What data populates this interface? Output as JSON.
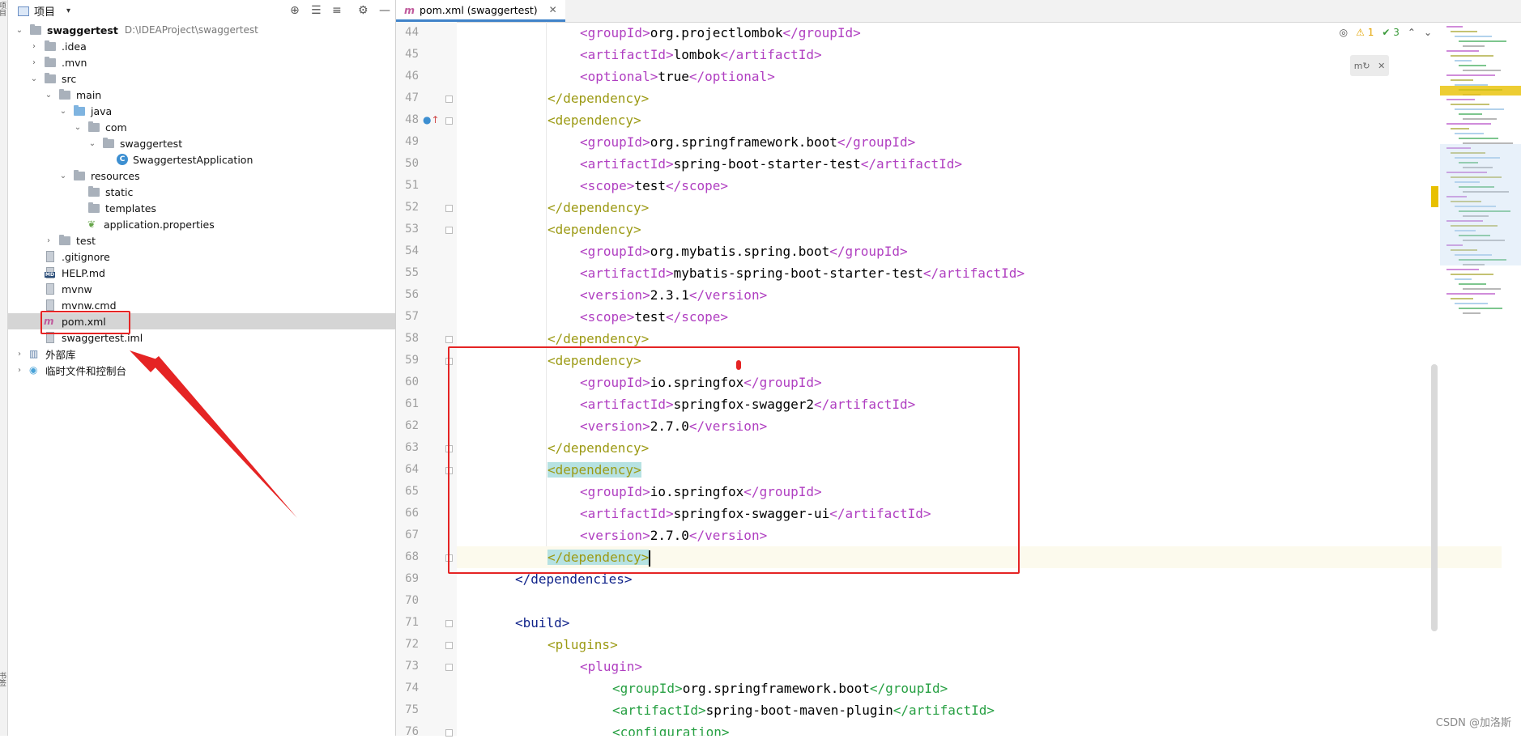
{
  "toolstrip": {
    "top_label": "项目",
    "bottom_label": "书签"
  },
  "project_panel": {
    "title": "项目",
    "dropdown_icon": "chevron-down-icon",
    "header_icons": [
      "locate-icon",
      "expand-all-icon",
      "collapse-all-icon",
      "gear-icon",
      "minimize-icon"
    ],
    "tree": [
      {
        "label": "swaggertest",
        "path": "D:\\IDEAProject\\swaggertest",
        "depth": 0,
        "arrow": "open",
        "icon": "folder-icon",
        "bold": true
      },
      {
        "label": ".idea",
        "depth": 1,
        "arrow": "closed",
        "icon": "folder-icon"
      },
      {
        "label": ".mvn",
        "depth": 1,
        "arrow": "closed",
        "icon": "folder-icon"
      },
      {
        "label": "src",
        "depth": 1,
        "arrow": "open",
        "icon": "folder-icon"
      },
      {
        "label": "main",
        "depth": 2,
        "arrow": "open",
        "icon": "folder-icon"
      },
      {
        "label": "java",
        "depth": 3,
        "arrow": "open",
        "icon": "source-folder-icon"
      },
      {
        "label": "com",
        "depth": 4,
        "arrow": "open",
        "icon": "package-icon"
      },
      {
        "label": "swaggertest",
        "depth": 5,
        "arrow": "open",
        "icon": "package-icon"
      },
      {
        "label": "SwaggertestApplication",
        "depth": 6,
        "arrow": "",
        "icon": "spring-class-icon"
      },
      {
        "label": "resources",
        "depth": 3,
        "arrow": "open",
        "icon": "resources-folder-icon"
      },
      {
        "label": "static",
        "depth": 4,
        "arrow": "",
        "icon": "folder-icon"
      },
      {
        "label": "templates",
        "depth": 4,
        "arrow": "",
        "icon": "folder-icon"
      },
      {
        "label": "application.properties",
        "depth": 4,
        "arrow": "",
        "icon": "spring-properties-icon"
      },
      {
        "label": "test",
        "depth": 2,
        "arrow": "closed",
        "icon": "folder-icon"
      },
      {
        "label": ".gitignore",
        "depth": 1,
        "arrow": "",
        "icon": "gitignore-file-icon"
      },
      {
        "label": "HELP.md",
        "depth": 1,
        "arrow": "",
        "icon": "markdown-file-icon"
      },
      {
        "label": "mvnw",
        "depth": 1,
        "arrow": "",
        "icon": "script-file-icon"
      },
      {
        "label": "mvnw.cmd",
        "depth": 1,
        "arrow": "",
        "icon": "cmd-file-icon"
      },
      {
        "label": "pom.xml",
        "depth": 1,
        "arrow": "",
        "icon": "maven-file-icon",
        "selected": true
      },
      {
        "label": "swaggertest.iml",
        "depth": 1,
        "arrow": "",
        "icon": "iml-file-icon"
      },
      {
        "label": "外部库",
        "depth": 0,
        "arrow": "closed",
        "icon": "library-icon"
      },
      {
        "label": "临时文件和控制台",
        "depth": 0,
        "arrow": "closed",
        "icon": "scratches-icon"
      }
    ]
  },
  "editor": {
    "tab_label": "pom.xml (swaggertest)",
    "tab_icon": "maven-icon",
    "inspection": {
      "warnings": "1",
      "ok": "3"
    },
    "maven_reload_icon": "maven-reload-icon",
    "lines": [
      {
        "n": "44",
        "indent": 3,
        "parts": [
          [
            "t",
            "<groupId>"
          ],
          [
            "txt",
            "org.projectlombok"
          ],
          [
            "t",
            "</groupId>"
          ]
        ]
      },
      {
        "n": "45",
        "indent": 3,
        "parts": [
          [
            "t",
            "<artifactId>"
          ],
          [
            "txt",
            "lombok"
          ],
          [
            "t",
            "</artifactId>"
          ]
        ]
      },
      {
        "n": "46",
        "indent": 3,
        "parts": [
          [
            "t",
            "<optional>"
          ],
          [
            "txt",
            "true"
          ],
          [
            "t",
            "</optional>"
          ]
        ]
      },
      {
        "n": "47",
        "indent": 2,
        "parts": [
          [
            "t2",
            "</dependency>"
          ]
        ],
        "fold": true
      },
      {
        "n": "48",
        "indent": 2,
        "parts": [
          [
            "t2",
            "<dependency>"
          ]
        ],
        "fold": true,
        "gicon": true
      },
      {
        "n": "49",
        "indent": 3,
        "parts": [
          [
            "t",
            "<groupId>"
          ],
          [
            "txt",
            "org.springframework.boot"
          ],
          [
            "t",
            "</groupId>"
          ]
        ]
      },
      {
        "n": "50",
        "indent": 3,
        "parts": [
          [
            "t",
            "<artifactId>"
          ],
          [
            "txt",
            "spring-boot-starter-test"
          ],
          [
            "t",
            "</artifactId>"
          ]
        ]
      },
      {
        "n": "51",
        "indent": 3,
        "parts": [
          [
            "t",
            "<scope>"
          ],
          [
            "txt",
            "test"
          ],
          [
            "t",
            "</scope>"
          ]
        ]
      },
      {
        "n": "52",
        "indent": 2,
        "parts": [
          [
            "t2",
            "</dependency>"
          ]
        ],
        "fold": true
      },
      {
        "n": "53",
        "indent": 2,
        "parts": [
          [
            "t2",
            "<dependency>"
          ]
        ],
        "fold": true
      },
      {
        "n": "54",
        "indent": 3,
        "parts": [
          [
            "t",
            "<groupId>"
          ],
          [
            "txt",
            "org.mybatis.spring.boot"
          ],
          [
            "t",
            "</groupId>"
          ]
        ]
      },
      {
        "n": "55",
        "indent": 3,
        "parts": [
          [
            "t",
            "<artifactId>"
          ],
          [
            "txt",
            "mybatis-spring-boot-starter-test"
          ],
          [
            "t",
            "</artifactId>"
          ]
        ]
      },
      {
        "n": "56",
        "indent": 3,
        "parts": [
          [
            "t",
            "<version>"
          ],
          [
            "txt",
            "2.3.1"
          ],
          [
            "t",
            "</version>"
          ]
        ]
      },
      {
        "n": "57",
        "indent": 3,
        "parts": [
          [
            "t",
            "<scope>"
          ],
          [
            "txt",
            "test"
          ],
          [
            "t",
            "</scope>"
          ]
        ]
      },
      {
        "n": "58",
        "indent": 2,
        "parts": [
          [
            "t2",
            "</dependency>"
          ]
        ],
        "fold": true
      },
      {
        "n": "59",
        "indent": 2,
        "parts": [
          [
            "t2",
            "<dependency>"
          ]
        ],
        "fold": true
      },
      {
        "n": "60",
        "indent": 3,
        "parts": [
          [
            "t",
            "<groupId>"
          ],
          [
            "txt",
            "io.springfox"
          ],
          [
            "t",
            "</groupId>"
          ]
        ]
      },
      {
        "n": "61",
        "indent": 3,
        "parts": [
          [
            "t",
            "<artifactId>"
          ],
          [
            "txt",
            "springfox-swagger2"
          ],
          [
            "t",
            "</artifactId>"
          ]
        ]
      },
      {
        "n": "62",
        "indent": 3,
        "parts": [
          [
            "t",
            "<version>"
          ],
          [
            "txt",
            "2.7.0"
          ],
          [
            "t",
            "</version>"
          ]
        ]
      },
      {
        "n": "63",
        "indent": 2,
        "parts": [
          [
            "t2",
            "</dependency>"
          ]
        ],
        "fold": true
      },
      {
        "n": "64",
        "indent": 2,
        "parts": [
          [
            "t2 hl",
            "<dependency>"
          ]
        ],
        "fold": true
      },
      {
        "n": "65",
        "indent": 3,
        "parts": [
          [
            "t",
            "<groupId>"
          ],
          [
            "txt",
            "io.springfox"
          ],
          [
            "t",
            "</groupId>"
          ]
        ]
      },
      {
        "n": "66",
        "indent": 3,
        "parts": [
          [
            "t",
            "<artifactId>"
          ],
          [
            "txt",
            "springfox-swagger-ui"
          ],
          [
            "t",
            "</artifactId>"
          ]
        ]
      },
      {
        "n": "67",
        "indent": 3,
        "parts": [
          [
            "t",
            "<version>"
          ],
          [
            "txt",
            "2.7.0"
          ],
          [
            "t",
            "</version>"
          ]
        ]
      },
      {
        "n": "68",
        "indent": 2,
        "parts": [
          [
            "t2 hl",
            "</dependency>"
          ]
        ],
        "fold": true,
        "caret": true
      },
      {
        "n": "69",
        "indent": 1,
        "parts": [
          [
            "t3",
            "</dependencies>"
          ]
        ]
      },
      {
        "n": "70",
        "indent": 0,
        "parts": []
      },
      {
        "n": "71",
        "indent": 1,
        "parts": [
          [
            "t3",
            "<build>"
          ]
        ],
        "fold": true
      },
      {
        "n": "72",
        "indent": 2,
        "parts": [
          [
            "t2",
            "<plugins>"
          ]
        ],
        "fold": true
      },
      {
        "n": "73",
        "indent": 3,
        "parts": [
          [
            "t",
            "<plugin>"
          ]
        ],
        "fold": true
      },
      {
        "n": "74",
        "indent": 4,
        "parts": [
          [
            "t4",
            "<groupId>"
          ],
          [
            "txt",
            "org.springframework.boot"
          ],
          [
            "t4",
            "</groupId>"
          ]
        ]
      },
      {
        "n": "75",
        "indent": 4,
        "parts": [
          [
            "t4",
            "<artifactId>"
          ],
          [
            "txt",
            "spring-boot-maven-plugin"
          ],
          [
            "t4",
            "</artifactId>"
          ]
        ]
      },
      {
        "n": "76",
        "indent": 4,
        "parts": [
          [
            "t4",
            "<configuration>"
          ]
        ],
        "fold": true
      }
    ]
  },
  "watermark": "CSDN @加洛斯",
  "colors": {
    "annotation_red": "#e52424",
    "selection": "#d5d5d5",
    "tab_accent": "#4083c9"
  }
}
